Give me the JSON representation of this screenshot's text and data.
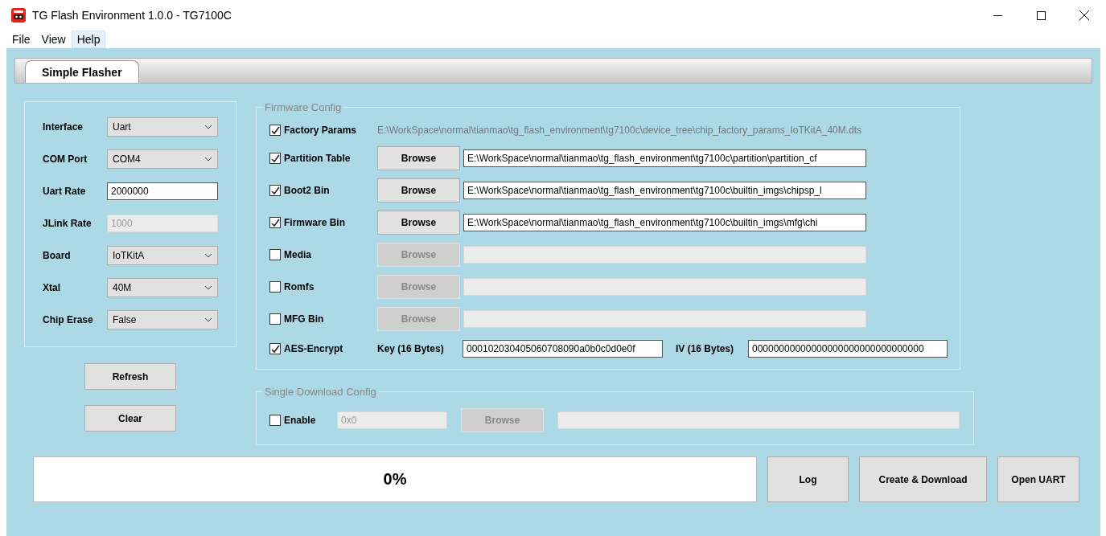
{
  "window": {
    "title": "TG Flash Environment 1.0.0 - TG7100C"
  },
  "menu": [
    {
      "label": "File",
      "highlighted": false
    },
    {
      "label": "View",
      "highlighted": false
    },
    {
      "label": "Help",
      "highlighted": true
    }
  ],
  "tabs": [
    {
      "label": "Simple Flasher",
      "selected": true
    }
  ],
  "settings": [
    {
      "kind": "select",
      "label": "Interface",
      "value": "Uart"
    },
    {
      "kind": "select",
      "label": "COM Port",
      "value": "COM4"
    },
    {
      "kind": "input",
      "label": "Uart Rate",
      "value": "2000000",
      "disabled": false
    },
    {
      "kind": "input",
      "label": "JLink Rate",
      "value": "1000",
      "disabled": true
    },
    {
      "kind": "select",
      "label": "Board",
      "value": "IoTKitA"
    },
    {
      "kind": "select",
      "label": "Xtal",
      "value": "40M"
    },
    {
      "kind": "select",
      "label": "Chip Erase",
      "value": "False"
    }
  ],
  "side_buttons": [
    "Refresh",
    "Clear"
  ],
  "firmware_config": {
    "title": "Firmware Config",
    "rows": [
      {
        "kind": "path",
        "label": "Factory Params",
        "checked": true,
        "path": "E:\\WorkSpace\\normal\\tianmao\\tg_flash_environment\\tg7100c\\device_tree\\chip_factory_params_IoTKitA_40M.dts"
      },
      {
        "kind": "browse",
        "label": "Partition Table",
        "checked": true,
        "button": "Browse",
        "path": "E:\\WorkSpace\\normal\\tianmao\\tg_flash_environment\\tg7100c\\partition\\partition_cf"
      },
      {
        "kind": "browse",
        "label": "Boot2 Bin",
        "checked": true,
        "button": "Browse",
        "path": "E:\\WorkSpace\\normal\\tianmao\\tg_flash_environment\\tg7100c\\builtin_imgs\\chipsp_l"
      },
      {
        "kind": "browse",
        "label": "Firmware Bin",
        "checked": true,
        "button": "Browse",
        "path": "E:\\WorkSpace\\normal\\tianmao\\tg_flash_environment\\tg7100c\\builtin_imgs\\mfg\\chi"
      },
      {
        "kind": "browse",
        "label": "Media",
        "checked": false,
        "button": "Browse"
      },
      {
        "kind": "browse",
        "label": "Romfs",
        "checked": false,
        "button": "Browse"
      },
      {
        "kind": "browse",
        "label": "MFG Bin",
        "checked": false,
        "button": "Browse"
      },
      {
        "kind": "aes",
        "label": "AES-Encrypt",
        "checked": true,
        "key_label": "Key (16 Bytes)",
        "key": "000102030405060708090a0b0c0d0e0f",
        "iv_label": "IV (16 Bytes)",
        "iv": "00000000000000000000000000000000"
      }
    ]
  },
  "single_download": {
    "title": "Single Download Config",
    "label": "Enable",
    "checked": false,
    "address": "0x0",
    "button": "Browse"
  },
  "progress": {
    "text": "0%"
  },
  "action_buttons": [
    "Log",
    "Create & Download",
    "Open UART"
  ]
}
